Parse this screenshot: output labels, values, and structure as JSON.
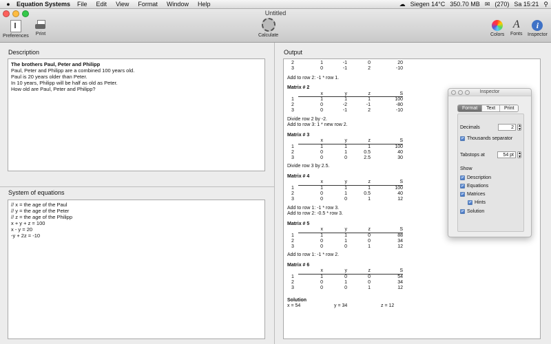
{
  "menubar": {
    "app_name": "Equation Systems",
    "menus": [
      "File",
      "Edit",
      "View",
      "Format",
      "Window",
      "Help"
    ],
    "weather": "Siegen 14°C",
    "memory": "350.70 MB",
    "count": "(270)",
    "clock": "Sa 15:21"
  },
  "window": {
    "title": "Untitled",
    "toolbar": {
      "preferences": "Preferences",
      "print": "Print",
      "calculate": "Calculate",
      "colors": "Colors",
      "fonts": "Fonts",
      "inspector": "Inspector"
    }
  },
  "description": {
    "title": "Description",
    "lines": [
      "The brothers Paul, Peter and Philipp",
      "",
      "Paul, Peter and Philipp are a combined 100 years old.",
      "Paul is 20 years older than Peter.",
      "In 10 years, Philipp will be half as old as Peter.",
      "",
      "How old are Paul, Peter and Philipp?"
    ]
  },
  "equations": {
    "title": "System of equations",
    "lines": [
      "// x = the age of the Paul",
      "// y = the age of the Peter",
      "// z = the age of the Philipp",
      "",
      "x + y + z = 100",
      "x - y = 20",
      "-y + 2z = -10"
    ]
  },
  "output": {
    "title": "Output",
    "top_rows": [
      [
        "2",
        "1",
        "-1",
        "0",
        "20"
      ],
      [
        "3",
        "0",
        "-1",
        "2",
        "-10"
      ]
    ],
    "top_ops": [
      "Add to row 2: -1 * row 1."
    ],
    "headers": [
      "x",
      "y",
      "z",
      "S"
    ],
    "matrices": [
      {
        "title": "Matrix # 2",
        "rows": [
          [
            "1",
            "1",
            "1",
            "1",
            "100"
          ],
          [
            "2",
            "0",
            "-2",
            "-1",
            "-80"
          ],
          [
            "3",
            "0",
            "-1",
            "2",
            "-10"
          ]
        ],
        "ops": [
          "Divide row 2 by -2.",
          "Add to row 3: 1 * new row 2."
        ]
      },
      {
        "title": "Matrix # 3",
        "rows": [
          [
            "1",
            "1",
            "1",
            "1",
            "100"
          ],
          [
            "2",
            "0",
            "1",
            "0.5",
            "40"
          ],
          [
            "3",
            "0",
            "0",
            "2.5",
            "30"
          ]
        ],
        "ops": [
          "Divide row 3 by 2.5."
        ]
      },
      {
        "title": "Matrix # 4",
        "rows": [
          [
            "1",
            "1",
            "1",
            "1",
            "100"
          ],
          [
            "2",
            "0",
            "1",
            "0.5",
            "40"
          ],
          [
            "3",
            "0",
            "0",
            "1",
            "12"
          ]
        ],
        "ops": [
          "Add to row 1: -1 * row 3.",
          "Add to row 2: -0.5 * row 3."
        ]
      },
      {
        "title": "Matrix # 5",
        "rows": [
          [
            "1",
            "1",
            "1",
            "0",
            "88"
          ],
          [
            "2",
            "0",
            "1",
            "0",
            "34"
          ],
          [
            "3",
            "0",
            "0",
            "1",
            "12"
          ]
        ],
        "ops": [
          "Add to row 1: -1 * row 2."
        ]
      },
      {
        "title": "Matrix # 6",
        "rows": [
          [
            "1",
            "1",
            "0",
            "0",
            "54"
          ],
          [
            "2",
            "0",
            "1",
            "0",
            "34"
          ],
          [
            "3",
            "0",
            "0",
            "1",
            "12"
          ]
        ],
        "ops": []
      }
    ],
    "solution_title": "Solution",
    "solution": [
      "x = 54",
      "y = 34",
      "z = 12"
    ]
  },
  "inspector": {
    "title": "Inspector",
    "tabs": [
      "Format",
      "Text",
      "Print"
    ],
    "decimals_label": "Decimals",
    "decimals_value": "2",
    "thousands_label": "Thousands separator",
    "tabstops_label": "Tabstops at",
    "tabstops_value": "54 pt",
    "show_label": "Show",
    "show_items": [
      "Description",
      "Equations",
      "Matrices",
      "Hints",
      "Solution"
    ]
  }
}
